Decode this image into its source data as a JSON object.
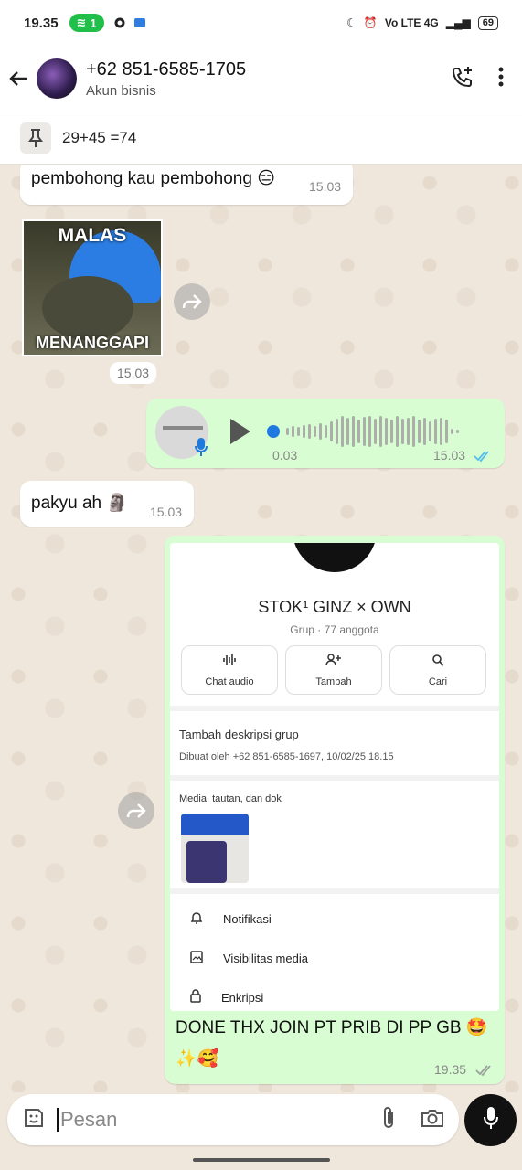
{
  "status": {
    "time": "19.35",
    "hotspot_count": "1",
    "network": "Vo LTE 4G",
    "battery": "69"
  },
  "header": {
    "name": "+62 851-6585-1705",
    "subtitle": "Akun bisnis"
  },
  "pinned": {
    "text": "29+45 =74"
  },
  "messages": {
    "m1": {
      "text": "pembohong kau pembohong 😑",
      "time": "15.03"
    },
    "sticker": {
      "top_text": "MALAS",
      "bottom_text": "MENANGGAPI",
      "time": "15.03"
    },
    "voice": {
      "duration": "0.03",
      "time": "15.03"
    },
    "m2": {
      "text": "pakyu ah 🗿",
      "time": "15.03"
    },
    "screenshot": {
      "group_name": "STOK¹ GINZ × OWN",
      "group_sub": "Grup · 77 anggota",
      "btn_audio": "Chat audio",
      "btn_add": "Tambah",
      "btn_search": "Cari",
      "desc_title": "Tambah deskripsi grup",
      "desc_created": "Dibuat oleh +62 851-6585-1697, 10/02/25 18.15",
      "media_title": "Media, tautan, dan dok",
      "menu_notif": "Notifikasi",
      "menu_visibility": "Visibilitas media",
      "menu_encrypt": "Enkripsi"
    },
    "m3": {
      "caption": "DONE THX JOIN PT PRIB DI PP GB 🤩",
      "caption2": "✨🥰",
      "time": "19.35"
    }
  },
  "composer": {
    "placeholder": "Pesan"
  },
  "colors": {
    "outgoing_bubble": "#d8fdd2",
    "incoming_bubble": "#ffffff",
    "read_tick": "#53bdeb",
    "hotspot": "#1fbf4a"
  }
}
